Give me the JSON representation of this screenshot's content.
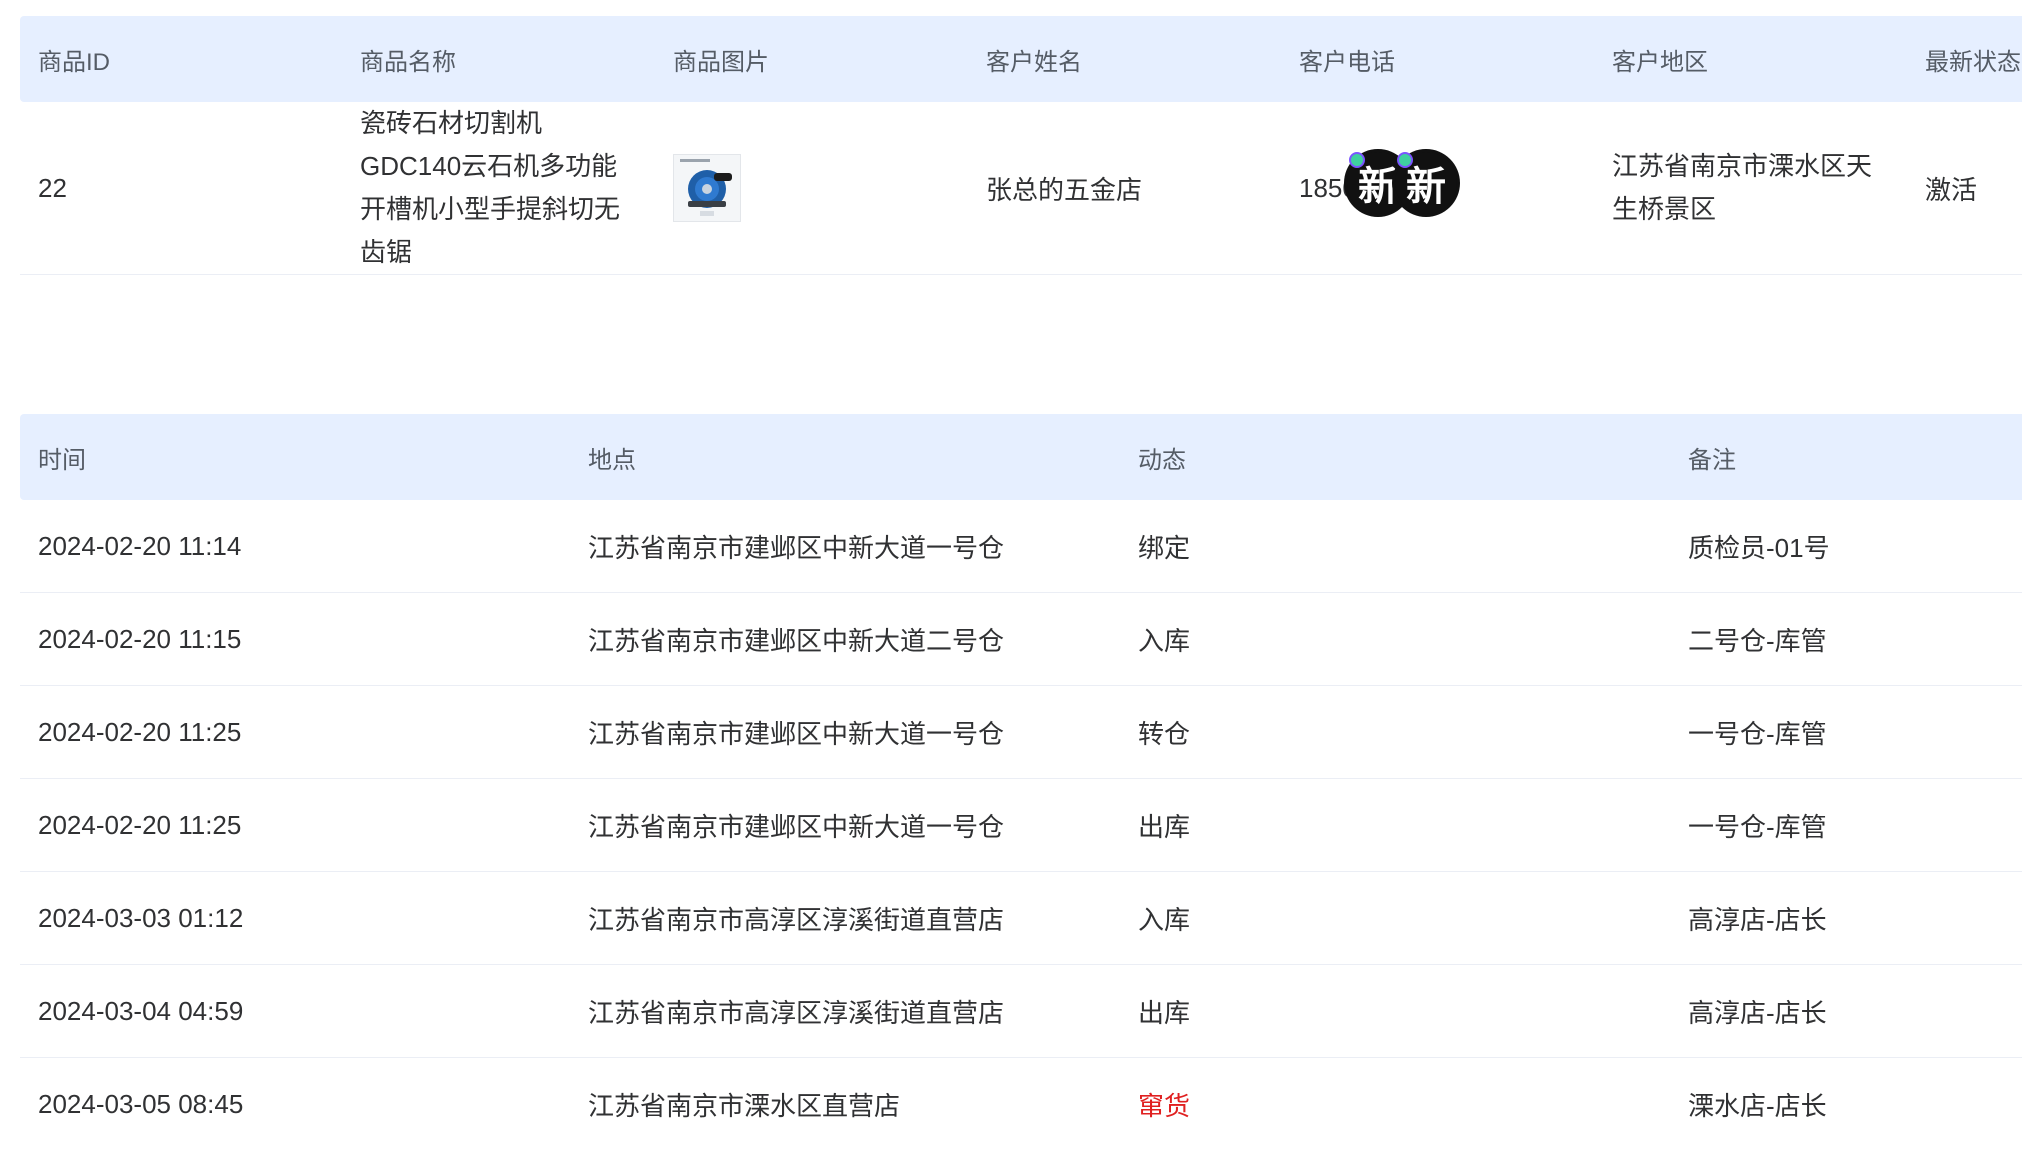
{
  "product_table": {
    "headers": [
      "商品ID",
      "商品名称",
      "商品图片",
      "客户姓名",
      "客户电话",
      "客户地区",
      "最新状态"
    ],
    "row": {
      "id": "22",
      "name": "瓷砖石材切割机GDC140云石机多功能开槽机小型手提斜切无齿锯",
      "image_icon": "circular-saw-product-image",
      "customer_name": "张总的五金店",
      "phone_visible": "1850",
      "sticker_text_1": "新",
      "sticker_text_2": "新",
      "region": "江苏省南京市溧水区天生桥景区",
      "status": "激活"
    }
  },
  "track_table": {
    "headers": [
      "时间",
      "地点",
      "动态",
      "备注"
    ],
    "rows": [
      {
        "time": "2024-02-20 11:14",
        "place": "江苏省南京市建邺区中新大道一号仓",
        "event": "绑定",
        "note": "质检员-01号"
      },
      {
        "time": "2024-02-20 11:15",
        "place": "江苏省南京市建邺区中新大道二号仓",
        "event": "入库",
        "note": "二号仓-库管"
      },
      {
        "time": "2024-02-20 11:25",
        "place": "江苏省南京市建邺区中新大道一号仓",
        "event": "转仓",
        "note": "一号仓-库管"
      },
      {
        "time": "2024-02-20 11:25",
        "place": "江苏省南京市建邺区中新大道一号仓",
        "event": "出库",
        "note": "一号仓-库管"
      },
      {
        "time": "2024-03-03 01:12",
        "place": "江苏省南京市高淳区淳溪街道直营店",
        "event": "入库",
        "note": "高淳店-店长"
      },
      {
        "time": "2024-03-04 04:59",
        "place": "江苏省南京市高淳区淳溪街道直营店",
        "event": "出库",
        "note": "高淳店-店长"
      },
      {
        "time": "2024-03-05 08:45",
        "place": "江苏省南京市溧水区直营店",
        "event": "窜货",
        "note": "溧水店-店长"
      }
    ]
  },
  "colors": {
    "header_bg": "#e6efff",
    "alert_red": "#e02020"
  }
}
